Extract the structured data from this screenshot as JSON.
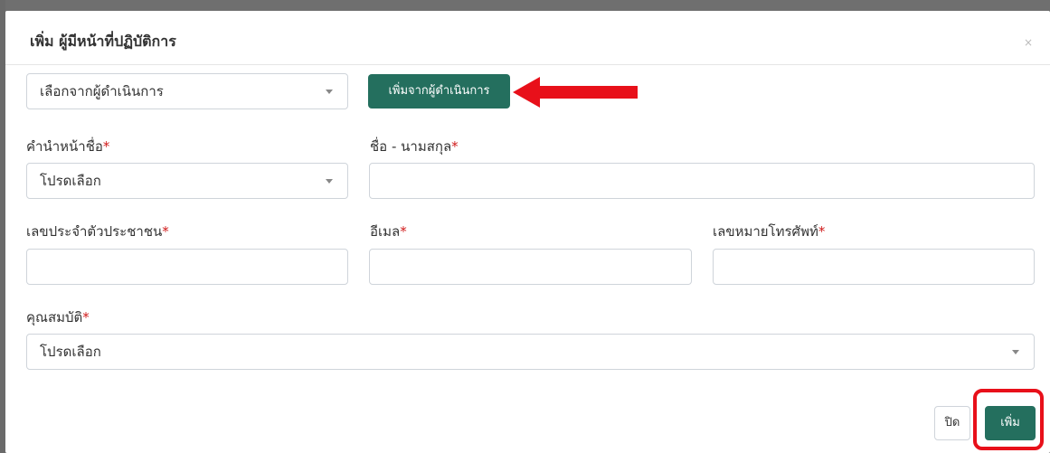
{
  "modal": {
    "title": "เพิ่ม ผู้มีหน้าที่ปฏิบัติการ",
    "close_glyph": "×"
  },
  "operator_select": {
    "value": "เลือกจากผู้ดำเนินการ",
    "add_button_label": "เพิ่มจากผู้ดำเนินการ"
  },
  "fields": {
    "prefix": {
      "label": "คำนำหน้าชื่อ",
      "required_mark": "*",
      "value": "โปรดเลือก"
    },
    "fullname": {
      "label": "ชื่อ - นามสกุล",
      "required_mark": "*",
      "value": ""
    },
    "citizen_id": {
      "label": "เลขประจำตัวประชาชน",
      "required_mark": "*",
      "value": ""
    },
    "email": {
      "label": "อีเมล",
      "required_mark": "*",
      "value": ""
    },
    "phone": {
      "label": "เลขหมายโทรศัพท์",
      "required_mark": "*",
      "value": ""
    },
    "qualification": {
      "label": "คุณสมบัติ",
      "required_mark": "*",
      "value": "โปรดเลือก"
    }
  },
  "footer": {
    "close_label": "ปิด",
    "submit_label": "เพิ่ม"
  },
  "colors": {
    "primary_green": "#246f5e",
    "required_red": "#d01a1a",
    "annotation_red": "#e8101a"
  }
}
